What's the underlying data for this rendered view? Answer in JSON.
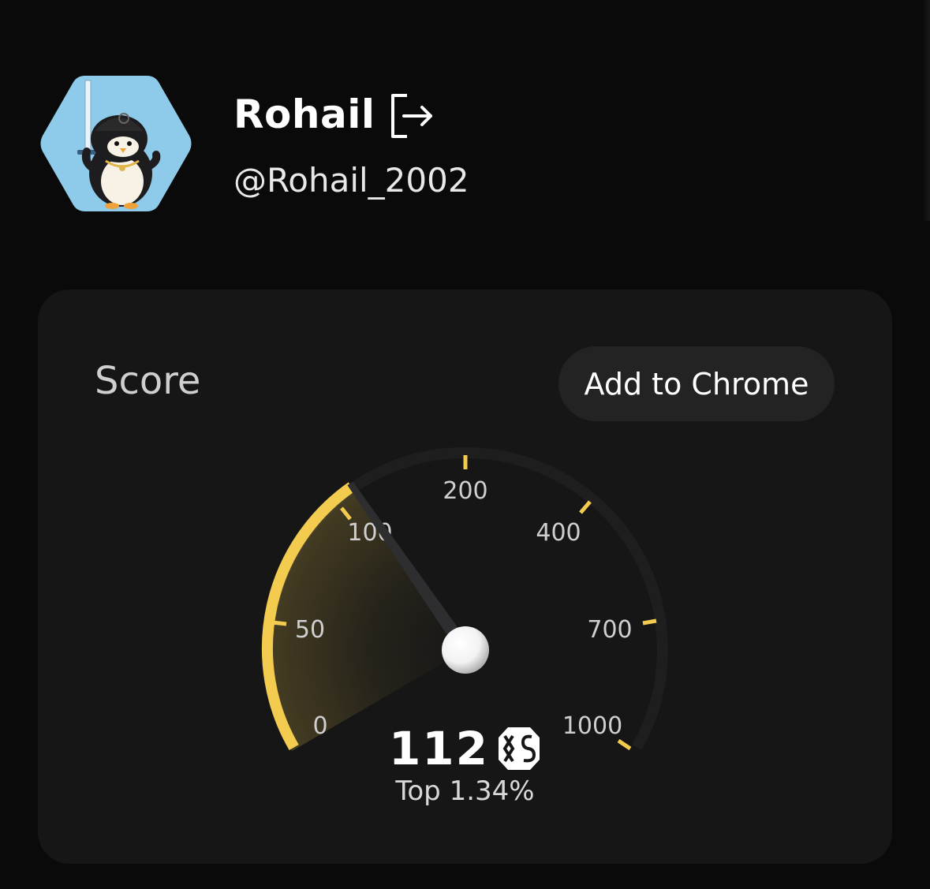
{
  "profile": {
    "name": "Rohail",
    "handle": "@Rohail_2002",
    "avatar_icon": "penguin-with-sword-avatar",
    "logout_icon": "logout-icon"
  },
  "score_card": {
    "title": "Score",
    "add_to_chrome_label": "Add to Chrome",
    "score": "112",
    "score_badge_icon": "xs-logo-icon",
    "rank_text": "Top 1.34%"
  },
  "gauge": {
    "ticks": [
      "0",
      "50",
      "100",
      "200",
      "400",
      "700",
      "1000"
    ],
    "value": 112,
    "accent_color": "#f2cb4f",
    "track_color": "#1e1e1e"
  },
  "colors": {
    "background": "#0a0a0a",
    "card": "#161616",
    "button": "#232323",
    "avatar_bg": "#8ecbea"
  }
}
